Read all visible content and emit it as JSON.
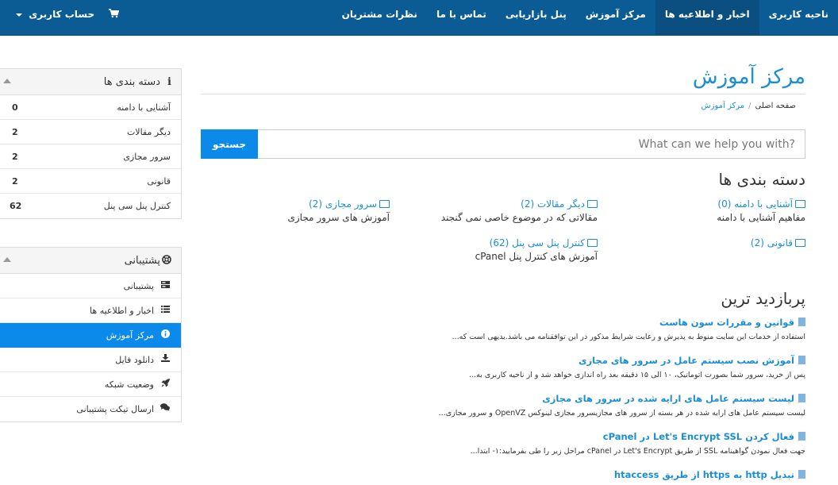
{
  "navbar": {
    "items": [
      "ناحیه کاربری",
      "اخبار و اطلاعیه ها",
      "مرکز آموزش",
      "پنل بازاریابی",
      "تماس با ما",
      "نظرات مشتریان"
    ],
    "account_label": "حساب کاربری",
    "cart_icon": "shopping-cart-icon"
  },
  "sidebar": {
    "categories": {
      "title": "دسته بندی ها",
      "items": [
        {
          "label": "آشنایی با دامنه",
          "count": "0"
        },
        {
          "label": "دیگر مقالات",
          "count": "2"
        },
        {
          "label": "سرور مجازی",
          "count": "2"
        },
        {
          "label": "قانونی",
          "count": "2"
        },
        {
          "label": "کنترل پنل سی پنل",
          "count": "62"
        }
      ]
    },
    "support": {
      "title": "پشتیبانی",
      "items": [
        {
          "label": "پشتیبانی",
          "icon": "server-icon"
        },
        {
          "label": "اخبار و اطلاعیه ها",
          "icon": "list-icon"
        },
        {
          "label": "مرکز آموزش",
          "icon": "info-circle-icon"
        },
        {
          "label": "دانلود فایل",
          "icon": "download-icon"
        },
        {
          "label": "وضعیت شبکه",
          "icon": "rocket-icon"
        },
        {
          "label": "ارسال تیکت پشتیبانی",
          "icon": "comments-icon"
        }
      ]
    }
  },
  "main": {
    "title": "مرکز آموزش",
    "breadcrumb": {
      "home": "صفحه اصلی",
      "separator": "/",
      "current": "مرکز آموزش"
    },
    "search": {
      "placeholder": "What can we help you with?",
      "button": "جستجو"
    },
    "categories_heading": "دسته بندی ها",
    "categories": [
      {
        "label": "آشنایی با دامنه (0)",
        "desc": "مفاهیم آشنایی با دامنه"
      },
      {
        "label": "دیگر مقالات (2)",
        "desc": "مقالاتی که در موضوع خاصی نمی گنجند"
      },
      {
        "label": "سرور مجازی (2)",
        "desc": "آموزش های سرور مجازی"
      },
      {
        "label": "قانونی (2)",
        "desc": ""
      },
      {
        "label": "کنترل پنل سی پنل (62)",
        "desc": "آموزش های کنترل پنل cPanel"
      }
    ],
    "popular_heading": "پربازدید ترین",
    "articles": [
      {
        "title": "قوانین و مقررات سون هاست",
        "desc": "استفاده از خدمات این سایت منوط به پذیرش و رعایت شرایط مذکور در این توافقنامه می باشد.بدیهی است که..."
      },
      {
        "title": "آموزش نصب سیستم عامل در سرور های مجازی",
        "desc": "پس از خرید، سرور شما بصورت اتوماتیک، ۱۰ الی ۱۵ دقیقه بعد راه اندازی خواهد شد و از ناحیه کاربری به..."
      },
      {
        "title": "لیست سیستم عامل های ارایه شده در سرور های مجازی",
        "desc": "لیست سیستم عامل های ارایه شده در هر بسته از سرور های مجازیسرور مجازی لینوکس OpenVZ و سرور مجازی..."
      },
      {
        "title": "فعال کردن Let's Encrypt SSL در cPanel",
        "desc": "جهت فعال نمودن گواهینامه SSL از طریق Let's Encrypt در cPanel مراحل زیر را طی بفرمایید:۱- ابتدا..."
      },
      {
        "title": "تبدیل http به https از طریق htaccess",
        "desc": ""
      }
    ]
  }
}
